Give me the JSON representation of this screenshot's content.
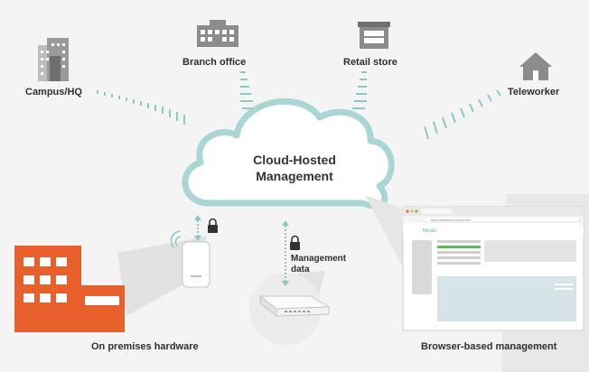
{
  "sites": {
    "campus": "Campus/HQ",
    "branch": "Branch office",
    "retail": "Retail store",
    "teleworker": "Teleworker"
  },
  "cloud": {
    "line1": "Cloud-Hosted",
    "line2": "Management"
  },
  "management_data": {
    "line1": "Management",
    "line2": "data"
  },
  "captions": {
    "on_premises": "On premises hardware",
    "browser": "Browser-based management"
  },
  "browser": {
    "url": "https://dashboard.meraki.com",
    "logo": "Meraki"
  },
  "colors": {
    "cloud_edge": "#a9d6d3",
    "signal": "#8cc9c6",
    "building_orange": "#e8612c",
    "icon_gray": "#8c8c8c",
    "accent_green": "#5cb85c",
    "panel_blue": "#d6e4ea"
  }
}
